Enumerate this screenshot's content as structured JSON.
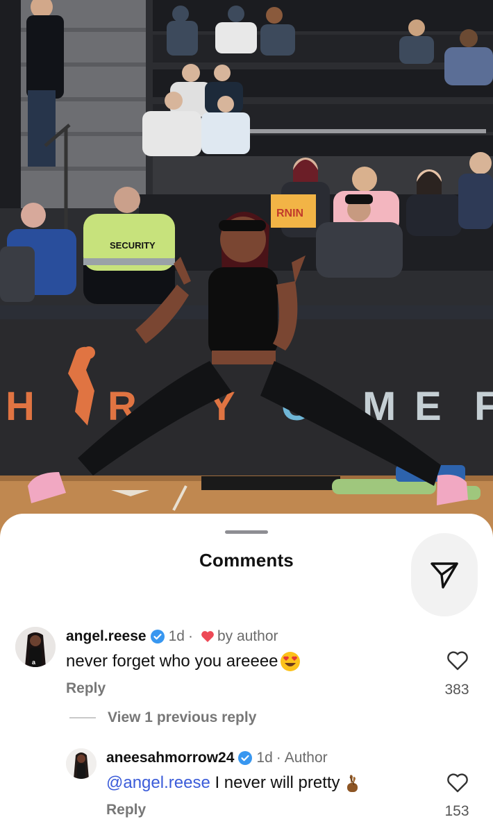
{
  "sheet": {
    "title": "Comments"
  },
  "comments": [
    {
      "username": "angel.reese",
      "time": "1d",
      "separator": "·",
      "liked_by_author_label": "by author",
      "text": "never forget who you areeee",
      "emoji": "heart-eyes-emoji",
      "reply_label": "Reply",
      "like_count": "383"
    }
  ],
  "view_previous": "View 1 previous reply",
  "replies": [
    {
      "username": "aneesahmorrow24",
      "time": "1d",
      "separator": "·",
      "author_badge": "Author",
      "mention": "@angel.reese",
      "text": " I never will pretty",
      "emoji": "fingers-crossed-emoji",
      "reply_label": "Reply",
      "like_count": "153"
    }
  ],
  "photo": {
    "court_letters": [
      "H",
      "R",
      "Y",
      "C",
      "M",
      "E",
      "F"
    ],
    "sign_text": "RNIN",
    "security_label": "SECURITY"
  },
  "colors": {
    "verified": "#3897f0",
    "heart": "#ed4956",
    "mention": "#3b5cd9"
  }
}
